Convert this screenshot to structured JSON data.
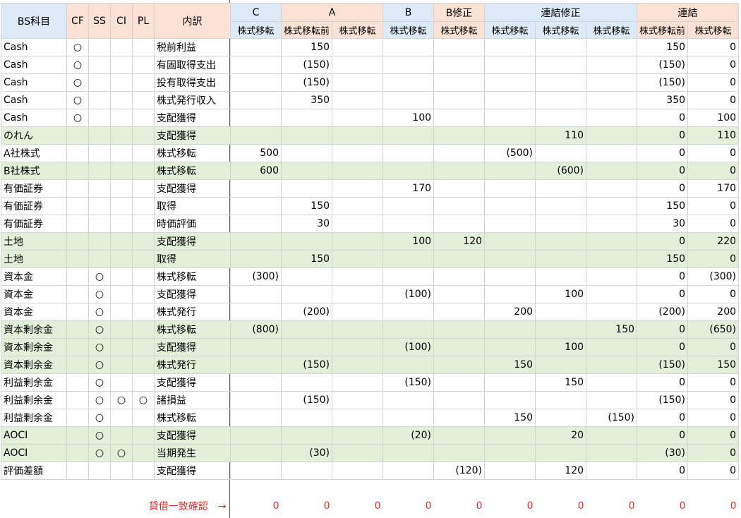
{
  "header": {
    "col_bs": "BS科目",
    "col_cf": "CF",
    "col_ss": "SS",
    "col_ci": "CI",
    "col_pl": "PL",
    "col_detail": "内訳",
    "groups": [
      "C",
      "A",
      "B",
      "B修正",
      "連結修正",
      "連結"
    ],
    "sub": [
      "株式移転",
      "株式移転前",
      "株式移転",
      "株式移転",
      "株式移転",
      "株式移転",
      "株式移転",
      "株式移転",
      "株式移転前",
      "株式移転"
    ]
  },
  "rows": [
    {
      "bs": "Cash",
      "cf": "○",
      "ss": "",
      "ci": "",
      "pl": "",
      "detail": "税前利益",
      "v": [
        "",
        "150",
        "",
        "",
        "",
        "",
        "",
        "",
        "150",
        "0"
      ],
      "green": false
    },
    {
      "bs": "Cash",
      "cf": "○",
      "ss": "",
      "ci": "",
      "pl": "",
      "detail": "有固取得支出",
      "v": [
        "",
        "(150)",
        "",
        "",
        "",
        "",
        "",
        "",
        "(150)",
        "0"
      ],
      "green": false
    },
    {
      "bs": "Cash",
      "cf": "○",
      "ss": "",
      "ci": "",
      "pl": "",
      "detail": "投有取得支出",
      "v": [
        "",
        "(150)",
        "",
        "",
        "",
        "",
        "",
        "",
        "(150)",
        "0"
      ],
      "green": false
    },
    {
      "bs": "Cash",
      "cf": "○",
      "ss": "",
      "ci": "",
      "pl": "",
      "detail": "株式発行収入",
      "v": [
        "",
        "350",
        "",
        "",
        "",
        "",
        "",
        "",
        "350",
        "0"
      ],
      "green": false
    },
    {
      "bs": "Cash",
      "cf": "○",
      "ss": "",
      "ci": "",
      "pl": "",
      "detail": "支配獲得",
      "v": [
        "",
        "",
        "",
        "100",
        "",
        "",
        "",
        "",
        "0",
        "100"
      ],
      "green": false
    },
    {
      "bs": "のれん",
      "cf": "",
      "ss": "",
      "ci": "",
      "pl": "",
      "detail": "支配獲得",
      "v": [
        "",
        "",
        "",
        "",
        "",
        "",
        "110",
        "",
        "0",
        "110"
      ],
      "green": true
    },
    {
      "bs": "A社株式",
      "cf": "",
      "ss": "",
      "ci": "",
      "pl": "",
      "detail": "株式移転",
      "v": [
        "500",
        "",
        "",
        "",
        "",
        "(500)",
        "",
        "",
        "0",
        "0"
      ],
      "green": false
    },
    {
      "bs": "B社株式",
      "cf": "",
      "ss": "",
      "ci": "",
      "pl": "",
      "detail": "株式移転",
      "v": [
        "600",
        "",
        "",
        "",
        "",
        "",
        "(600)",
        "",
        "0",
        "0"
      ],
      "green": true
    },
    {
      "bs": "有価証券",
      "cf": "",
      "ss": "",
      "ci": "",
      "pl": "",
      "detail": "支配獲得",
      "v": [
        "",
        "",
        "",
        "170",
        "",
        "",
        "",
        "",
        "0",
        "170"
      ],
      "green": false
    },
    {
      "bs": "有価証券",
      "cf": "",
      "ss": "",
      "ci": "",
      "pl": "",
      "detail": "取得",
      "v": [
        "",
        "150",
        "",
        "",
        "",
        "",
        "",
        "",
        "150",
        "0"
      ],
      "green": false
    },
    {
      "bs": "有価証券",
      "cf": "",
      "ss": "",
      "ci": "",
      "pl": "",
      "detail": "時価評価",
      "v": [
        "",
        "30",
        "",
        "",
        "",
        "",
        "",
        "",
        "30",
        "0"
      ],
      "green": false
    },
    {
      "bs": "土地",
      "cf": "",
      "ss": "",
      "ci": "",
      "pl": "",
      "detail": "支配獲得",
      "v": [
        "",
        "",
        "",
        "100",
        "120",
        "",
        "",
        "",
        "0",
        "220"
      ],
      "green": true
    },
    {
      "bs": "土地",
      "cf": "",
      "ss": "",
      "ci": "",
      "pl": "",
      "detail": "取得",
      "v": [
        "",
        "150",
        "",
        "",
        "",
        "",
        "",
        "",
        "150",
        "0"
      ],
      "green": true
    },
    {
      "bs": "資本金",
      "cf": "",
      "ss": "○",
      "ci": "",
      "pl": "",
      "detail": "株式移転",
      "v": [
        "(300)",
        "",
        "",
        "",
        "",
        "",
        "",
        "",
        "0",
        "(300)"
      ],
      "green": false
    },
    {
      "bs": "資本金",
      "cf": "",
      "ss": "○",
      "ci": "",
      "pl": "",
      "detail": "支配獲得",
      "v": [
        "",
        "",
        "",
        "(100)",
        "",
        "",
        "100",
        "",
        "0",
        "0"
      ],
      "green": false
    },
    {
      "bs": "資本金",
      "cf": "",
      "ss": "○",
      "ci": "",
      "pl": "",
      "detail": "株式発行",
      "v": [
        "",
        "(200)",
        "",
        "",
        "",
        "200",
        "",
        "",
        "(200)",
        "200"
      ],
      "green": false
    },
    {
      "bs": "資本剰余金",
      "cf": "",
      "ss": "○",
      "ci": "",
      "pl": "",
      "detail": "株式移転",
      "v": [
        "(800)",
        "",
        "",
        "",
        "",
        "",
        "",
        "150",
        "0",
        "(650)"
      ],
      "green": true
    },
    {
      "bs": "資本剰余金",
      "cf": "",
      "ss": "○",
      "ci": "",
      "pl": "",
      "detail": "支配獲得",
      "v": [
        "",
        "",
        "",
        "(100)",
        "",
        "",
        "100",
        "",
        "0",
        "0"
      ],
      "green": true
    },
    {
      "bs": "資本剰余金",
      "cf": "",
      "ss": "○",
      "ci": "",
      "pl": "",
      "detail": "株式発行",
      "v": [
        "",
        "(150)",
        "",
        "",
        "",
        "150",
        "",
        "",
        "(150)",
        "150"
      ],
      "green": true
    },
    {
      "bs": "利益剰余金",
      "cf": "",
      "ss": "○",
      "ci": "",
      "pl": "",
      "detail": "支配獲得",
      "v": [
        "",
        "",
        "",
        "(150)",
        "",
        "",
        "150",
        "",
        "0",
        "0"
      ],
      "green": false
    },
    {
      "bs": "利益剰余金",
      "cf": "",
      "ss": "○",
      "ci": "○",
      "pl": "○",
      "detail": "諸損益",
      "v": [
        "",
        "(150)",
        "",
        "",
        "",
        "",
        "",
        "",
        "(150)",
        "0"
      ],
      "green": false
    },
    {
      "bs": "利益剰余金",
      "cf": "",
      "ss": "○",
      "ci": "",
      "pl": "",
      "detail": "株式移転",
      "v": [
        "",
        "",
        "",
        "",
        "",
        "150",
        "",
        "(150)",
        "0",
        "0"
      ],
      "green": false
    },
    {
      "bs": "AOCI",
      "cf": "",
      "ss": "○",
      "ci": "",
      "pl": "",
      "detail": "支配獲得",
      "v": [
        "",
        "",
        "",
        "(20)",
        "",
        "",
        "20",
        "",
        "0",
        "0"
      ],
      "green": true
    },
    {
      "bs": "AOCI",
      "cf": "",
      "ss": "○",
      "ci": "○",
      "pl": "",
      "detail": "当期発生",
      "v": [
        "",
        "(30)",
        "",
        "",
        "",
        "",
        "",
        "",
        "(30)",
        "0"
      ],
      "green": true
    },
    {
      "bs": "評価差額",
      "cf": "",
      "ss": "",
      "ci": "",
      "pl": "",
      "detail": "支配獲得",
      "v": [
        "",
        "",
        "",
        "",
        "(120)",
        "",
        "120",
        "",
        "0",
        "0"
      ],
      "green": false
    }
  ],
  "check": {
    "label": "貸借一致確認　→",
    "values": [
      "0",
      "0",
      "0",
      "0",
      "0",
      "0",
      "0",
      "0",
      "0",
      "0"
    ]
  }
}
